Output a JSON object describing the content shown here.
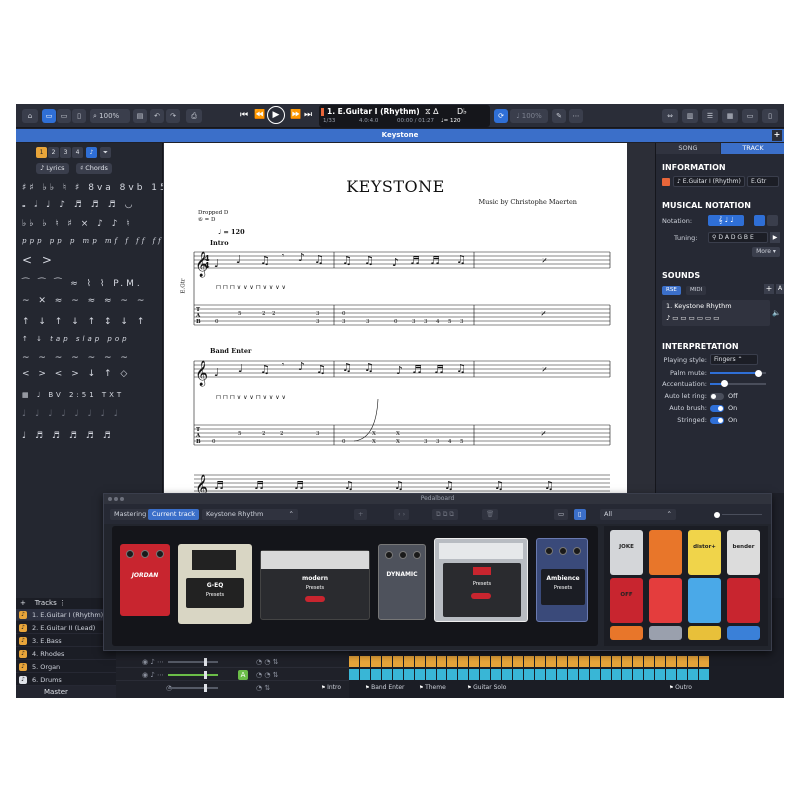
{
  "toolbar": {
    "zoom": "100%",
    "zoom2": "100%",
    "track_name": "1. E.Guitar I (Rhythm)",
    "bar_position": "1/33",
    "time_signature": "4.0:4.0",
    "time": "00:00 / 01:27",
    "tempo": "♩= 120",
    "key": "D♭"
  },
  "title_bar": {
    "title": "Keystone"
  },
  "palette": {
    "voice_numbers": [
      "1",
      "2",
      "3",
      "4"
    ],
    "lyrics_label": "Lyrics",
    "chords_label": "Chords",
    "rows": [
      "♯♯ ♭♭ ♮ ♯ 8va 8vb 15ma 15mb",
      "𝅝 𝅗𝅥 ♩ ♪ ♬ ♬ ♬ ◡",
      "♭♭ ♭ ♮ ♯ × ♪ ♪ ♮",
      "ppp pp p mp mf f ff fff",
      "< >",
      "⁀ ⁀ ⁀ ≈ ⌇ ⌇ P.M.",
      "~ ✕ ≈ ~ ≈ ≈ ~ ~",
      "↑ ↓ ↑ ↓ ↑ ↕ ↓ ↑",
      "↑ ↓ tap slap pop",
      "~ ~ ~ ~ ~ ~ ~",
      "< > < > ↓ ↑ ◇",
      "▦ ♩ BV 2:51 TXT",
      "♩ ♩ ♩ ♩ ♩ ♩ ♩ ♩",
      "♩ ♬ ♬ ♬ ♬ ♬"
    ]
  },
  "score": {
    "title": "KEYSTONE",
    "composer": "Music by Christophe Maerten",
    "tuning_line1": "Dropped D",
    "tuning_line2": "⑥ = D",
    "tempo": "♩ = 120",
    "section_intro": "Intro",
    "section_band": "Band Enter",
    "instrument": "E.Gtr",
    "tab_numbers_1": [
      "0",
      "5",
      "2",
      "2",
      "3",
      "3",
      "0",
      "3",
      "3",
      "4",
      "5",
      "3",
      "0",
      "0",
      "3",
      "0",
      "3"
    ],
    "tab_numbers_2": [
      "0",
      "5",
      "2",
      "2",
      "3",
      "0",
      "X",
      "X",
      "3",
      "3",
      "4",
      "5",
      "0",
      "X",
      "X",
      "3",
      "0"
    ]
  },
  "inspector": {
    "tab_song": "SONG",
    "tab_track": "TRACK",
    "information_title": "INFORMATION",
    "track_full_name": "E.Guitar I (Rhythm)",
    "track_short_name": "E.Gtr",
    "musical_notation_title": "MUSICAL NOTATION",
    "notation_label": "Notation:",
    "tuning_label": "Tuning:",
    "tuning_value": "D A D G B E",
    "more_label": "More",
    "sounds_title": "SOUNDS",
    "sound_tab_rse": "RSE",
    "sound_tab_midi": "MIDI",
    "sound_preset": "1. Keystone Rhythm",
    "interpretation_title": "INTERPRETATION",
    "playing_style_label": "Playing style:",
    "playing_style_value": "Fingers",
    "palm_mute_label": "Palm mute:",
    "palm_mute_level": 0.85,
    "accentuation_label": "Accentuation:",
    "accentuation_level": 0.25,
    "auto_let_ring_label": "Auto let ring:",
    "auto_let_ring_value": "Off",
    "auto_brush_label": "Auto brush:",
    "auto_brush_value": "On",
    "stringed_label": "Stringed:",
    "stringed_value": "On"
  },
  "pedalboard": {
    "window_title": "Pedalboard",
    "tab_mastering": "Mastering",
    "tab_current_track": "Current track",
    "preset": "Keystone Rhythm",
    "filter": "All",
    "pedals": [
      {
        "label": "JORDAN",
        "color": "#c8252f"
      },
      {
        "label": "G-EQ",
        "color": "#d9d6c4"
      },
      {
        "label": "modern",
        "color": "#2a2b2f"
      },
      {
        "label": "DYNAMIC",
        "color": "#4e525c"
      },
      {
        "label": "",
        "color": "#b8bcc2"
      },
      {
        "label": "Ambience",
        "color": "#3a4a7a"
      }
    ],
    "presets_label": "Presets",
    "off_label": "Off",
    "on_label": "On",
    "library": [
      {
        "label": "JOKE",
        "color": "#d4d6d9"
      },
      {
        "label": "",
        "color": "#e8762a"
      },
      {
        "label": "distor+",
        "color": "#f0d44a"
      },
      {
        "label": "bender",
        "color": "#dcdcdc"
      },
      {
        "label": "OFF",
        "color": "#c8252f"
      },
      {
        "label": "",
        "color": "#e43d3d"
      },
      {
        "label": "",
        "color": "#4aa9e8"
      },
      {
        "label": "",
        "color": "#c8252f"
      },
      {
        "label": "",
        "color": "#e8762a"
      },
      {
        "label": "",
        "color": "#9aa0ad"
      },
      {
        "label": "",
        "color": "#e8c03a"
      },
      {
        "label": "",
        "color": "#3a80d8"
      }
    ]
  },
  "tracks": {
    "header": "Tracks",
    "items": [
      {
        "label": "1. E.Guitar I (Rhythm)",
        "icon": "guitar-icon"
      },
      {
        "label": "2. E.Guitar II (Lead)",
        "icon": "guitar-icon"
      },
      {
        "label": "3. E.Bass",
        "icon": "bass-icon"
      },
      {
        "label": "4. Rhodes",
        "icon": "keyboard-icon"
      },
      {
        "label": "5. Organ",
        "icon": "organ-icon"
      },
      {
        "label": "6. Drums",
        "icon": "drums-icon"
      }
    ],
    "master": "Master"
  },
  "timeline": {
    "markers": [
      "Intro",
      "Band Enter",
      "Theme",
      "Guitar Solo",
      "Outro"
    ],
    "colors": {
      "bar_orange": "#e8a53a",
      "bar_cyan": "#39b6d6"
    }
  },
  "colors": {
    "accent_blue": "#3b6fc9",
    "accent_orange": "#e8a53a",
    "dark_bg": "#1e2029"
  }
}
